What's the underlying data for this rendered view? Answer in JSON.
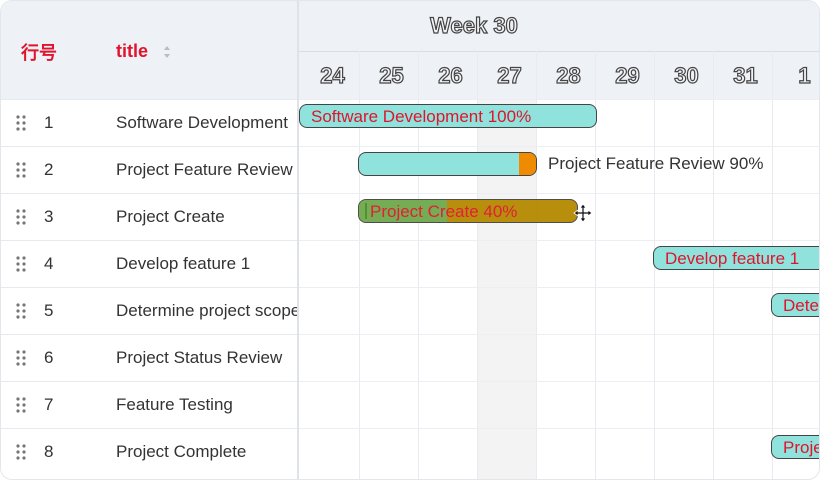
{
  "table": {
    "headers": {
      "index": "行号",
      "title": "title"
    },
    "rows": [
      {
        "index": "1",
        "title": "Software Development"
      },
      {
        "index": "2",
        "title": "Project Feature Review"
      },
      {
        "index": "3",
        "title": "Project Create"
      },
      {
        "index": "4",
        "title": "Develop feature 1"
      },
      {
        "index": "5",
        "title": "Determine project scope"
      },
      {
        "index": "6",
        "title": "Project Status Review"
      },
      {
        "index": "7",
        "title": "Feature Testing"
      },
      {
        "index": "8",
        "title": "Project Complete"
      }
    ]
  },
  "timeline": {
    "week": "Week 30",
    "days": [
      "24",
      "25",
      "26",
      "27",
      "28",
      "29",
      "30",
      "31",
      "1"
    ]
  },
  "bars": {
    "b1": {
      "label": "Software Development 100%",
      "progress": 100
    },
    "b2": {
      "label": "Project Feature Review 90%",
      "progress": 90
    },
    "b3": {
      "label": "Project Create 40%",
      "progress": 40
    },
    "b4": {
      "label": "Develop feature 1"
    },
    "b5": {
      "label": "Dete"
    },
    "b8": {
      "label": "Proje"
    }
  },
  "colors": {
    "accent_text": "#e0142d",
    "bar_fill": "#8fe3dc",
    "progress_orange": "#f08a00",
    "drag_bar_fill": "#b58a00",
    "drag_bar_progress": "#6fa84a"
  }
}
